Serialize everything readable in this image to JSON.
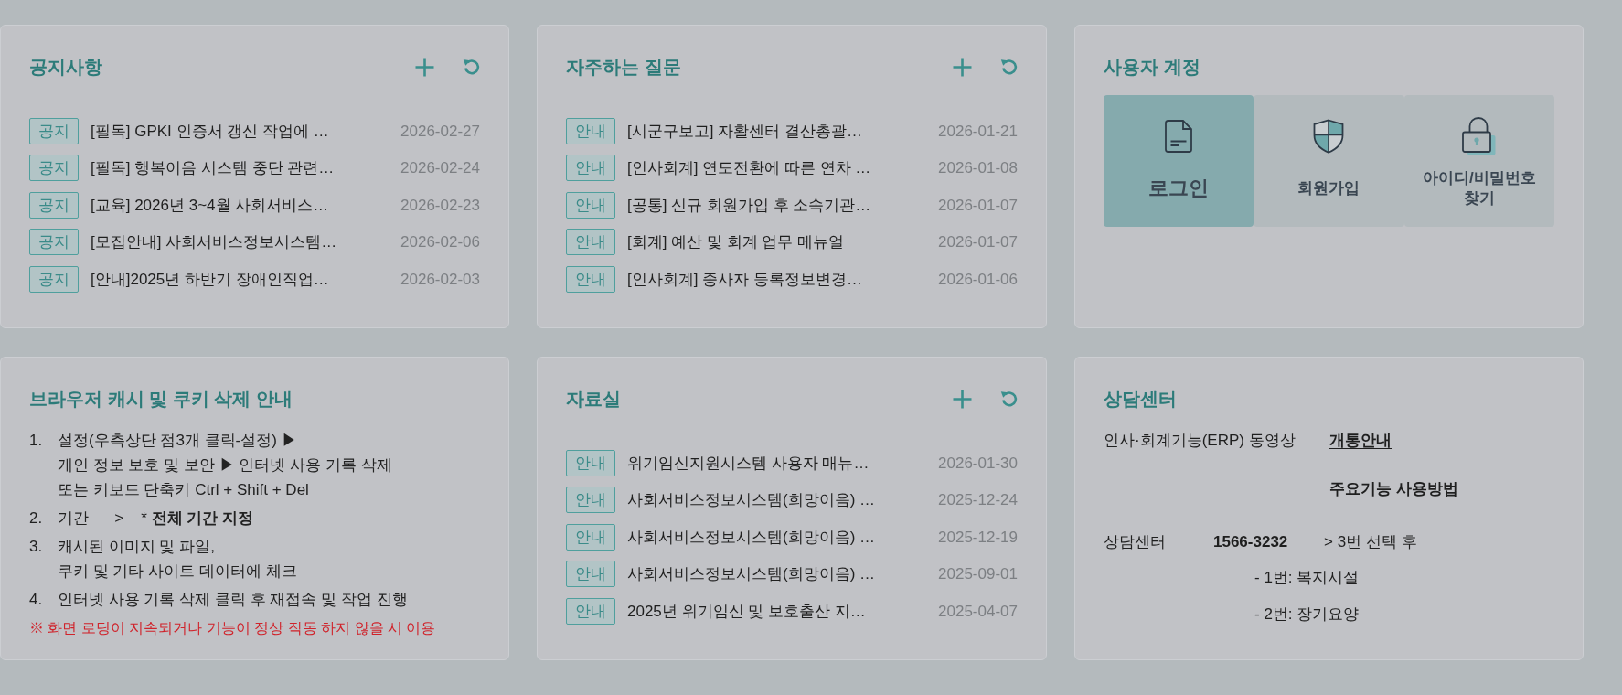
{
  "panels": [
    {
      "kind": "board",
      "title": "공지사항",
      "items": [
        {
          "tag": "공지",
          "title": "[필독] GPKI 인증서 갱신 작업에 …",
          "date": "2026-02-27"
        },
        {
          "tag": "공지",
          "title": "[필독] 행복이음 시스템 중단 관련…",
          "date": "2026-02-24"
        },
        {
          "tag": "공지",
          "title": "[교육] 2026년 3~4월 사회서비스…",
          "date": "2026-02-23"
        },
        {
          "tag": "공지",
          "title": "[모집안내] 사회서비스정보시스템…",
          "date": "2026-02-06"
        },
        {
          "tag": "공지",
          "title": "[안내]2025년 하반기 장애인직업…",
          "date": "2026-02-03"
        }
      ]
    },
    {
      "kind": "board",
      "title": "자주하는 질문",
      "items": [
        {
          "tag": "안내",
          "title": "[시군구보고] 자활센터 결산총괄…",
          "date": "2026-01-21"
        },
        {
          "tag": "안내",
          "title": "[인사회계] 연도전환에 따른 연차 …",
          "date": "2026-01-08"
        },
        {
          "tag": "안내",
          "title": "[공통] 신규 회원가입 후 소속기관…",
          "date": "2026-01-07"
        },
        {
          "tag": "안내",
          "title": "[회계] 예산 및 회계 업무 메뉴얼",
          "date": "2026-01-07"
        },
        {
          "tag": "안내",
          "title": "[인사회계] 종사자 등록정보변경…",
          "date": "2026-01-06"
        }
      ]
    },
    {
      "kind": "account",
      "title": "사용자 계정",
      "tiles": [
        {
          "label": "로그인",
          "selected": true
        },
        {
          "label": "회원가입",
          "selected": false
        },
        {
          "label": "아이디/비밀번호 찾기",
          "selected": false
        }
      ]
    },
    {
      "kind": "guide",
      "title": "브라우저 캐시 및 쿠키 삭제 안내",
      "steps": [
        {
          "number": "1.",
          "lines": [
            "설정(우측상단 점3개 클릭-설정) ▶",
            "개인 정보 보호 및 보안 ▶ 인터넷 사용 기록 삭제",
            "또는 키보드 단축키 Ctrl + Shift + Del"
          ]
        },
        {
          "number": "2.",
          "lines": [
            "기간      >    * **전체 기간 지정**"
          ]
        },
        {
          "number": "3.",
          "lines": [
            "캐시된 이미지 및 파일,",
            "쿠키 및 기타 사이트 데이터에 체크"
          ]
        },
        {
          "number": "4.",
          "lines": [
            "인터넷 사용 기록 삭제 클릭 후 재접속 및 작업 진행"
          ]
        }
      ],
      "note": "※ 화면 로딩이 지속되거나 기능이 정상 작동 하지 않을 시 이용"
    },
    {
      "kind": "board",
      "title": "자료실",
      "items": [
        {
          "tag": "안내",
          "title": "위기임신지원시스템 사용자 매뉴…",
          "date": "2026-01-30"
        },
        {
          "tag": "안내",
          "title": "사회서비스정보시스템(희망이음) …",
          "date": "2025-12-24"
        },
        {
          "tag": "안내",
          "title": "사회서비스정보시스템(희망이음) …",
          "date": "2025-12-19"
        },
        {
          "tag": "안내",
          "title": "사회서비스정보시스템(희망이음) …",
          "date": "2025-09-01"
        },
        {
          "tag": "안내",
          "title": "2025년 위기임신 및 보호출산 지…",
          "date": "2025-04-07"
        }
      ]
    },
    {
      "kind": "contact",
      "title": "상담센터",
      "video": {
        "label": "인사·회계기능(ERP) 동영상",
        "links": [
          "개통안내",
          "주요기능 사용방법"
        ]
      },
      "phone": {
        "label": "상담센터",
        "number": "1566-3232",
        "instruction": "> 3번 선택 후",
        "options": [
          "- 1번: 복지시설",
          "- 2번: 장기요양"
        ]
      }
    }
  ]
}
